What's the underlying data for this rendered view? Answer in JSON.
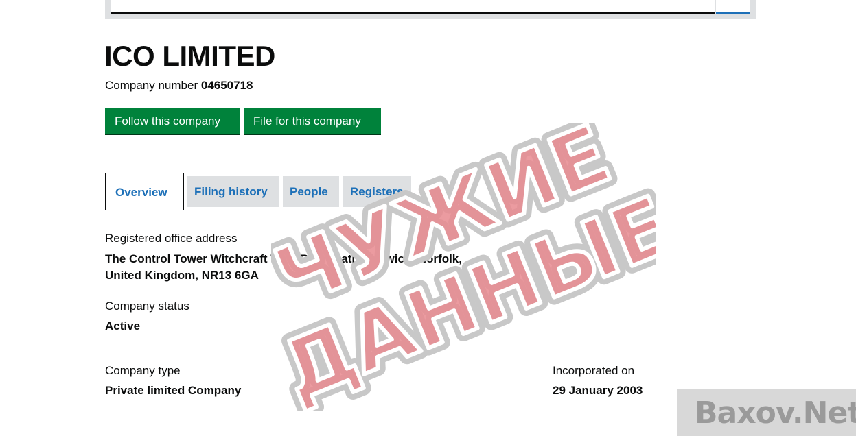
{
  "company": {
    "name": "ICO LIMITED",
    "number_label": "Company number",
    "number": "04650718"
  },
  "actions": {
    "follow_label": "Follow this company",
    "file_label": "File for this company"
  },
  "tabs": [
    {
      "label": "Overview",
      "active": true
    },
    {
      "label": "Filing history",
      "active": false
    },
    {
      "label": "People",
      "active": false
    },
    {
      "label": "Registers",
      "active": false
    }
  ],
  "overview": {
    "address_label": "Registered office address",
    "address_line1": "The Control Tower Witchcraft Way, Rackheath, Norwich, Norfolk,",
    "address_line2": "United Kingdom, NR13 6GA",
    "status_label": "Company status",
    "status": "Active",
    "type_label": "Company type",
    "type": "Private limited Company",
    "incorporated_label": "Incorporated on",
    "incorporated": "29 January 2003"
  },
  "watermarks": {
    "stamp_line1": "ЧУЖИЕ",
    "stamp_line2": "ДАННЫЕ",
    "stamp_color": "#e8898f",
    "site": "Baxov.Net"
  },
  "colors": {
    "button_green": "#00823b",
    "link_blue": "#1d70b8",
    "tab_grey": "#dee0e2",
    "text": "#0b0c0c"
  }
}
